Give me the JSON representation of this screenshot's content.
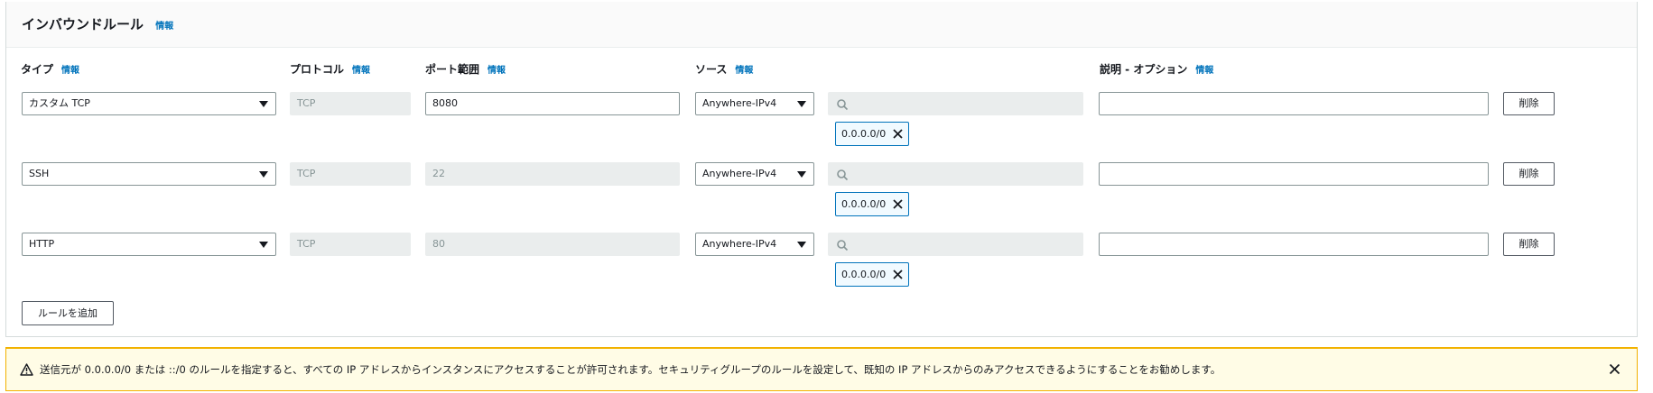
{
  "panel": {
    "title": "インバウンドルール",
    "info_label": "情報"
  },
  "columns": {
    "type": "タイプ",
    "protocol": "プロトコル",
    "port_range": "ポート範囲",
    "source": "ソース",
    "description": "説明 - オプション"
  },
  "rules": [
    {
      "type": "カスタム TCP",
      "protocol": "TCP",
      "port": "8080",
      "source": "Anywhere-IPv4",
      "cidr": "0.0.0.0/0",
      "description": "",
      "delete_label": "削除"
    },
    {
      "type": "SSH",
      "protocol": "TCP",
      "port": "22",
      "source": "Anywhere-IPv4",
      "cidr": "0.0.0.0/0",
      "description": "",
      "delete_label": "削除"
    },
    {
      "type": "HTTP",
      "protocol": "TCP",
      "port": "80",
      "source": "Anywhere-IPv4",
      "cidr": "0.0.0.0/0",
      "description": "",
      "delete_label": "削除"
    }
  ],
  "add_rule_label": "ルールを追加",
  "alert": {
    "text": "送信元が 0.0.0.0/0 または ::/0 のルールを指定すると、すべての IP アドレスからインスタンスにアクセスすることが許可されます。セキュリティグループのルールを設定して、既知の IP アドレスからのみアクセスできるようにすることをお勧めします。"
  },
  "colors": {
    "link": "#0073bb",
    "warning_border": "#f2b200",
    "warning_bg": "#fffce6",
    "token_border": "#0073bb"
  },
  "icons": {
    "caret": "caret-down-icon",
    "search": "search-icon",
    "remove": "close-icon",
    "warning": "warning-icon"
  }
}
